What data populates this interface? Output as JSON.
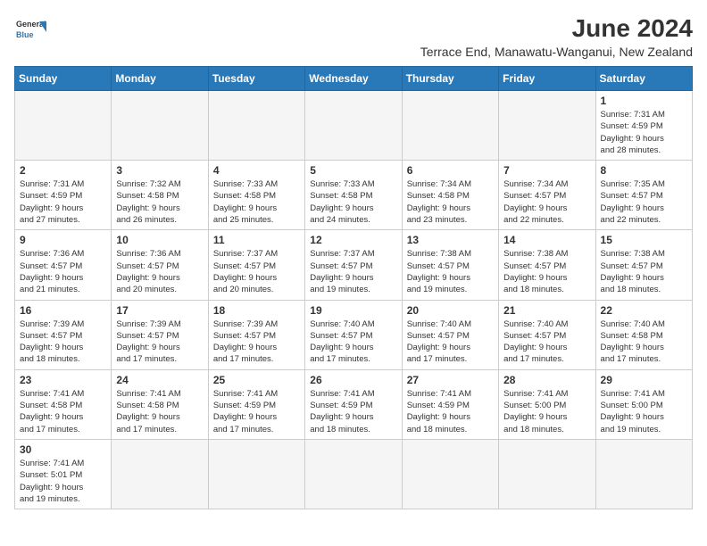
{
  "logo": {
    "line1": "General",
    "line2": "Blue"
  },
  "title": "June 2024",
  "subtitle": "Terrace End, Manawatu-Wanganui, New Zealand",
  "headers": [
    "Sunday",
    "Monday",
    "Tuesday",
    "Wednesday",
    "Thursday",
    "Friday",
    "Saturday"
  ],
  "weeks": [
    [
      {
        "day": "",
        "info": "",
        "empty": true
      },
      {
        "day": "",
        "info": "",
        "empty": true
      },
      {
        "day": "",
        "info": "",
        "empty": true
      },
      {
        "day": "",
        "info": "",
        "empty": true
      },
      {
        "day": "",
        "info": "",
        "empty": true
      },
      {
        "day": "",
        "info": "",
        "empty": true
      },
      {
        "day": "1",
        "info": "Sunrise: 7:31 AM\nSunset: 4:59 PM\nDaylight: 9 hours\nand 28 minutes."
      }
    ],
    [
      {
        "day": "2",
        "info": "Sunrise: 7:31 AM\nSunset: 4:59 PM\nDaylight: 9 hours\nand 27 minutes."
      },
      {
        "day": "3",
        "info": "Sunrise: 7:32 AM\nSunset: 4:58 PM\nDaylight: 9 hours\nand 26 minutes."
      },
      {
        "day": "4",
        "info": "Sunrise: 7:33 AM\nSunset: 4:58 PM\nDaylight: 9 hours\nand 25 minutes."
      },
      {
        "day": "5",
        "info": "Sunrise: 7:33 AM\nSunset: 4:58 PM\nDaylight: 9 hours\nand 24 minutes."
      },
      {
        "day": "6",
        "info": "Sunrise: 7:34 AM\nSunset: 4:58 PM\nDaylight: 9 hours\nand 23 minutes."
      },
      {
        "day": "7",
        "info": "Sunrise: 7:34 AM\nSunset: 4:57 PM\nDaylight: 9 hours\nand 22 minutes."
      },
      {
        "day": "8",
        "info": "Sunrise: 7:35 AM\nSunset: 4:57 PM\nDaylight: 9 hours\nand 22 minutes."
      }
    ],
    [
      {
        "day": "9",
        "info": "Sunrise: 7:36 AM\nSunset: 4:57 PM\nDaylight: 9 hours\nand 21 minutes."
      },
      {
        "day": "10",
        "info": "Sunrise: 7:36 AM\nSunset: 4:57 PM\nDaylight: 9 hours\nand 20 minutes."
      },
      {
        "day": "11",
        "info": "Sunrise: 7:37 AM\nSunset: 4:57 PM\nDaylight: 9 hours\nand 20 minutes."
      },
      {
        "day": "12",
        "info": "Sunrise: 7:37 AM\nSunset: 4:57 PM\nDaylight: 9 hours\nand 19 minutes."
      },
      {
        "day": "13",
        "info": "Sunrise: 7:38 AM\nSunset: 4:57 PM\nDaylight: 9 hours\nand 19 minutes."
      },
      {
        "day": "14",
        "info": "Sunrise: 7:38 AM\nSunset: 4:57 PM\nDaylight: 9 hours\nand 18 minutes."
      },
      {
        "day": "15",
        "info": "Sunrise: 7:38 AM\nSunset: 4:57 PM\nDaylight: 9 hours\nand 18 minutes."
      }
    ],
    [
      {
        "day": "16",
        "info": "Sunrise: 7:39 AM\nSunset: 4:57 PM\nDaylight: 9 hours\nand 18 minutes."
      },
      {
        "day": "17",
        "info": "Sunrise: 7:39 AM\nSunset: 4:57 PM\nDaylight: 9 hours\nand 17 minutes."
      },
      {
        "day": "18",
        "info": "Sunrise: 7:39 AM\nSunset: 4:57 PM\nDaylight: 9 hours\nand 17 minutes."
      },
      {
        "day": "19",
        "info": "Sunrise: 7:40 AM\nSunset: 4:57 PM\nDaylight: 9 hours\nand 17 minutes."
      },
      {
        "day": "20",
        "info": "Sunrise: 7:40 AM\nSunset: 4:57 PM\nDaylight: 9 hours\nand 17 minutes."
      },
      {
        "day": "21",
        "info": "Sunrise: 7:40 AM\nSunset: 4:57 PM\nDaylight: 9 hours\nand 17 minutes."
      },
      {
        "day": "22",
        "info": "Sunrise: 7:40 AM\nSunset: 4:58 PM\nDaylight: 9 hours\nand 17 minutes."
      }
    ],
    [
      {
        "day": "23",
        "info": "Sunrise: 7:41 AM\nSunset: 4:58 PM\nDaylight: 9 hours\nand 17 minutes."
      },
      {
        "day": "24",
        "info": "Sunrise: 7:41 AM\nSunset: 4:58 PM\nDaylight: 9 hours\nand 17 minutes."
      },
      {
        "day": "25",
        "info": "Sunrise: 7:41 AM\nSunset: 4:59 PM\nDaylight: 9 hours\nand 17 minutes."
      },
      {
        "day": "26",
        "info": "Sunrise: 7:41 AM\nSunset: 4:59 PM\nDaylight: 9 hours\nand 18 minutes."
      },
      {
        "day": "27",
        "info": "Sunrise: 7:41 AM\nSunset: 4:59 PM\nDaylight: 9 hours\nand 18 minutes."
      },
      {
        "day": "28",
        "info": "Sunrise: 7:41 AM\nSunset: 5:00 PM\nDaylight: 9 hours\nand 18 minutes."
      },
      {
        "day": "29",
        "info": "Sunrise: 7:41 AM\nSunset: 5:00 PM\nDaylight: 9 hours\nand 19 minutes."
      }
    ],
    [
      {
        "day": "30",
        "info": "Sunrise: 7:41 AM\nSunset: 5:01 PM\nDaylight: 9 hours\nand 19 minutes.",
        "last": true
      },
      {
        "day": "",
        "info": "",
        "empty": true,
        "last": true
      },
      {
        "day": "",
        "info": "",
        "empty": true,
        "last": true
      },
      {
        "day": "",
        "info": "",
        "empty": true,
        "last": true
      },
      {
        "day": "",
        "info": "",
        "empty": true,
        "last": true
      },
      {
        "day": "",
        "info": "",
        "empty": true,
        "last": true
      },
      {
        "day": "",
        "info": "",
        "empty": true,
        "last": true
      }
    ]
  ]
}
